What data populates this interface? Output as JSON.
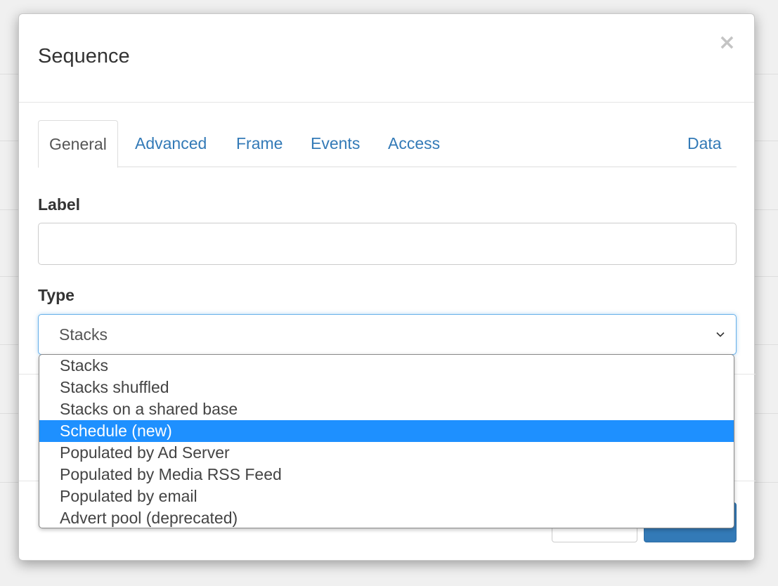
{
  "modal": {
    "title": "Sequence",
    "close_label": "×"
  },
  "tabs": [
    {
      "label": "General",
      "active": true
    },
    {
      "label": "Advanced",
      "active": false
    },
    {
      "label": "Frame",
      "active": false
    },
    {
      "label": "Events",
      "active": false
    },
    {
      "label": "Access",
      "active": false
    },
    {
      "label": "Data",
      "active": false
    }
  ],
  "form": {
    "label_field": {
      "label": "Label",
      "value": "",
      "placeholder": ""
    },
    "type_field": {
      "label": "Type",
      "value": "Stacks"
    }
  },
  "dropdown": {
    "options": [
      {
        "label": "Stacks",
        "highlighted": false
      },
      {
        "label": "Stacks shuffled",
        "highlighted": false
      },
      {
        "label": "Stacks on a shared base",
        "highlighted": false
      },
      {
        "label": "Schedule (new)",
        "highlighted": true
      },
      {
        "label": "Populated by Ad Server",
        "highlighted": false
      },
      {
        "label": "Populated by Media RSS Feed",
        "highlighted": false
      },
      {
        "label": "Populated by email",
        "highlighted": false
      },
      {
        "label": "Advert pool (deprecated)",
        "highlighted": false
      }
    ]
  },
  "colors": {
    "link": "#337ab7",
    "highlight": "#1e90ff",
    "primary_button": "#337ab7"
  }
}
